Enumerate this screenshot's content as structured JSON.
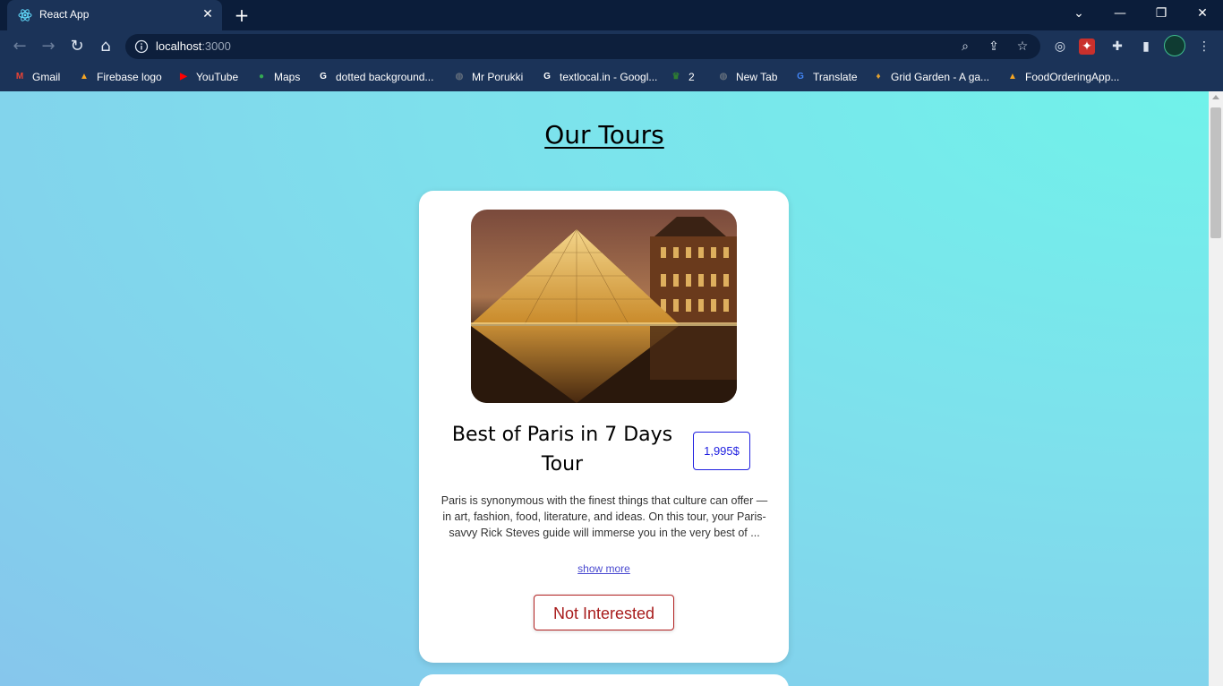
{
  "browser": {
    "tab": {
      "title": "React App",
      "favicon": "react-icon"
    },
    "window_controls": {
      "tab_search": "⌄",
      "minimize": "—",
      "restore": "❐",
      "close": "✕"
    },
    "address": {
      "host": "localhost",
      "port": ":3000"
    },
    "bookmarks": [
      {
        "label": "Gmail",
        "icon": "gmail-icon",
        "color": "#ea4335",
        "glyph": "M"
      },
      {
        "label": "Firebase logo",
        "icon": "firebase-icon",
        "color": "#f6a623",
        "glyph": "▲"
      },
      {
        "label": "YouTube",
        "icon": "youtube-icon",
        "color": "#ff0000",
        "glyph": "▶"
      },
      {
        "label": "Maps",
        "icon": "maps-icon",
        "color": "#34a853",
        "glyph": "●"
      },
      {
        "label": "dotted background...",
        "icon": "google-icon",
        "color": "#ffffff",
        "glyph": "G"
      },
      {
        "label": "Mr Porukki",
        "icon": "globe-icon",
        "color": "#5f6b7a",
        "glyph": "◍"
      },
      {
        "label": "textlocal.in - Googl...",
        "icon": "google-icon",
        "color": "#ffffff",
        "glyph": "G"
      },
      {
        "label": "2",
        "icon": "crown-icon",
        "color": "#2e7d32",
        "glyph": "♛"
      },
      {
        "label": "New Tab",
        "icon": "globe-icon",
        "color": "#5f6b7a",
        "glyph": "◍"
      },
      {
        "label": "Translate",
        "icon": "translate-icon",
        "color": "#4285f4",
        "glyph": "G"
      },
      {
        "label": "Grid Garden - A ga...",
        "icon": "carrot-icon",
        "color": "#e0a030",
        "glyph": "♦"
      },
      {
        "label": "FoodOrderingApp...",
        "icon": "firebase-icon",
        "color": "#f6a623",
        "glyph": "▲"
      }
    ]
  },
  "page": {
    "title": "Our Tours",
    "tour": {
      "name": "Best of Paris in 7 Days Tour",
      "price": "1,995$",
      "description": "Paris is synonymous with the finest things that culture can offer — in art, fashion, food, literature, and ideas. On this tour, your Paris-savvy Rick Steves guide will immerse you in the very best of ...",
      "show_more": "show more",
      "not_interested": "Not Interested"
    }
  },
  "colors": {
    "accent_blue": "#1f1fe0",
    "danger_red": "#a81c1c",
    "bg_cyan": "#70f2ea",
    "bg_blue": "#86c6ec"
  }
}
